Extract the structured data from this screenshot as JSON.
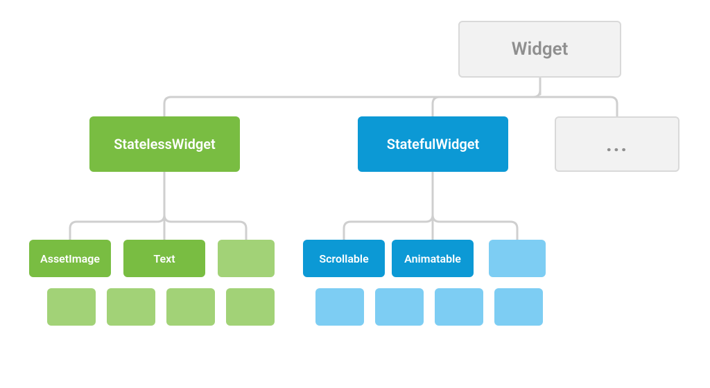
{
  "tree": {
    "root": {
      "label": "Widget"
    },
    "stateless": {
      "label": "StatelessWidget",
      "children": [
        {
          "label": "AssetImage"
        },
        {
          "label": "Text"
        },
        {
          "label": ""
        }
      ],
      "extras": [
        {
          "label": ""
        },
        {
          "label": ""
        },
        {
          "label": ""
        },
        {
          "label": ""
        }
      ]
    },
    "stateful": {
      "label": "StatefulWidget",
      "children": [
        {
          "label": "Scrollable"
        },
        {
          "label": "Animatable"
        },
        {
          "label": ""
        }
      ],
      "extras": [
        {
          "label": ""
        },
        {
          "label": ""
        },
        {
          "label": ""
        },
        {
          "label": ""
        }
      ]
    },
    "more": {
      "label": "..."
    }
  },
  "colors": {
    "green_dark": "#79bd42",
    "green_light": "#a2d277",
    "blue_dark": "#0c99d5",
    "blue_light": "#7dcdf3",
    "grey_fill": "#f2f2f2",
    "grey_border": "#d9d9d9",
    "grey_text": "#8f8f8f",
    "connector": "#cfcfcf"
  }
}
